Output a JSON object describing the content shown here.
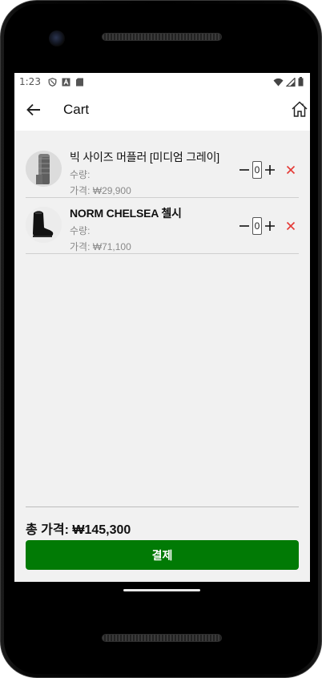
{
  "status_bar": {
    "time": "1:23",
    "icons": [
      "shield-icon",
      "a-badge-icon",
      "sd-card-icon"
    ],
    "right_icons": [
      "wifi-icon",
      "signal-icon",
      "battery-icon"
    ]
  },
  "app_bar": {
    "title": "Cart",
    "back_icon": "arrow-left-icon",
    "home_icon": "home-icon"
  },
  "cart": {
    "items": [
      {
        "name": "빅 사이즈 머플러 [미디엄 그레이]",
        "quantity_label": "수량:",
        "price_label": "가격: ₩29,900",
        "quantity": "0",
        "image": "gray-scarf"
      },
      {
        "name": "NORM CHELSEA 첼시",
        "quantity_label": "수량:",
        "price_label": "가격: ₩71,100",
        "quantity": "0",
        "image": "black-chelsea-boot"
      }
    ],
    "total_label": "총 가격: ₩145,300",
    "checkout_label": "결제"
  },
  "colors": {
    "checkout_button": "#017a05",
    "remove_icon": "#e53935",
    "screen_background": "#f1f1f1"
  }
}
